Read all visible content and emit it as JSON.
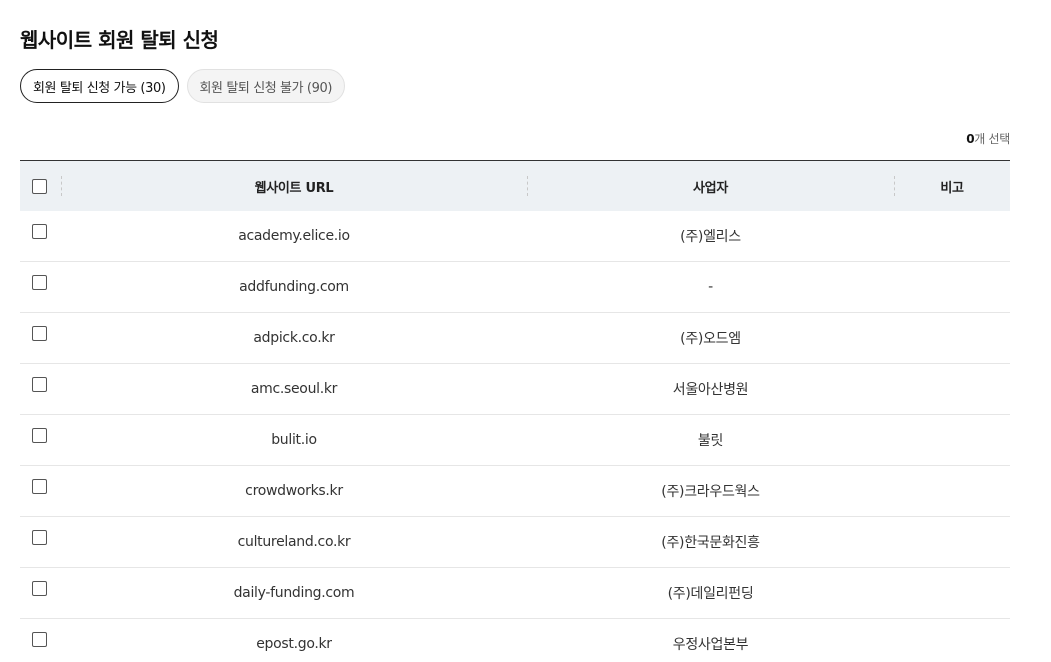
{
  "page": {
    "title": "웹사이트 회원 탈퇴 신청"
  },
  "tabs": [
    {
      "label": "회원 탈퇴 신청 가능 (30)",
      "active": true
    },
    {
      "label": "회원 탈퇴 신청 불가 (90)",
      "active": false
    }
  ],
  "selection": {
    "count": "0",
    "suffix": "개 선택"
  },
  "table": {
    "columns": {
      "url": "웹사이트 URL",
      "business": "사업자",
      "note": "비고"
    },
    "rows": [
      {
        "url": "academy.elice.io",
        "business": "(주)엘리스",
        "note": ""
      },
      {
        "url": "addfunding.com",
        "business": "-",
        "note": ""
      },
      {
        "url": "adpick.co.kr",
        "business": "(주)오드엠",
        "note": ""
      },
      {
        "url": "amc.seoul.kr",
        "business": "서울아산병원",
        "note": ""
      },
      {
        "url": "bulit.io",
        "business": "불릿",
        "note": ""
      },
      {
        "url": "crowdworks.kr",
        "business": "(주)크라우드웍스",
        "note": ""
      },
      {
        "url": "cultureland.co.kr",
        "business": "(주)한국문화진흥",
        "note": ""
      },
      {
        "url": "daily-funding.com",
        "business": "(주)데일리펀딩",
        "note": ""
      },
      {
        "url": "epost.go.kr",
        "business": "우정사업본부",
        "note": ""
      }
    ]
  },
  "colors": {
    "header_bg": "#edf1f4",
    "active_tab_border": "#222222",
    "inactive_tab_bg": "#f4f4f4"
  }
}
